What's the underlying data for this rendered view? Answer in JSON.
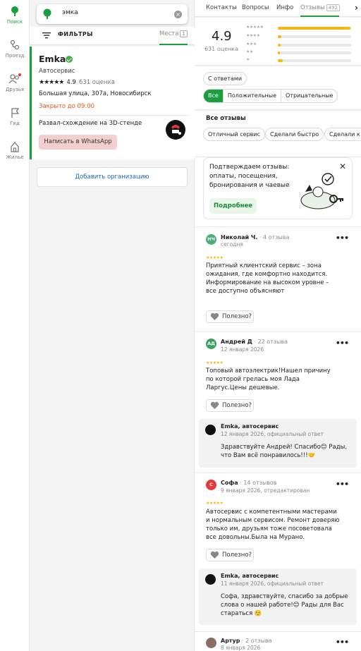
{
  "nav": {
    "items": [
      {
        "label": "Поиск",
        "icon": "search-pin-icon"
      },
      {
        "label": "Проезд",
        "icon": "route-icon"
      },
      {
        "label": "Друзья",
        "icon": "friends-icon"
      },
      {
        "label": "Гид",
        "icon": "flag-icon"
      },
      {
        "label": "Жильё",
        "icon": "home-icon"
      }
    ]
  },
  "search": {
    "query": "эмка"
  },
  "filters": {
    "label": "ФИЛЬТРЫ",
    "places_label": "Места",
    "places_count": "1"
  },
  "org": {
    "name": "Emka",
    "category": "Автосервис",
    "rating": "4.9",
    "reviews": "631 оценка",
    "address": "Большая улица, 307а, Новосибирск",
    "hours": "Закрыто до 09:00",
    "service": "Развал-схождение на 3D-стенде",
    "whatsapp": "Написать в WhatsApp",
    "accent": "#1a9e3f"
  },
  "add_org": "Добавить организацию",
  "tabs": [
    {
      "label": "Контакты"
    },
    {
      "label": "Вопросы"
    },
    {
      "label": "Инфо"
    },
    {
      "label": "Отзывы",
      "badge": "492"
    }
  ],
  "summary": {
    "avg": "4.9",
    "count": "631 оценка",
    "bars": [
      {
        "stars": "★★★★★",
        "fraction": 0.99
      },
      {
        "stars": "★★★★",
        "fraction": 0.05
      },
      {
        "stars": "★★★",
        "fraction": 0.04
      },
      {
        "stars": "★★",
        "fraction": 0.03
      },
      {
        "stars": "★",
        "fraction": 0.07
      }
    ]
  },
  "review_filters": {
    "with_answers": "С ответами",
    "segments": [
      "Все",
      "Положительные",
      "Отрицательные"
    ],
    "all_title": "Все отзывы",
    "tags": [
      "Отличный сервис",
      "Сделали быстро",
      "Сделали к"
    ]
  },
  "promo": {
    "text": "Подтверждаем отзывы: оплаты, посещения, бронирования и чаевые",
    "button": "Подробнее"
  },
  "reviews": [
    {
      "initials": "НЧ",
      "color": "#4caf7a",
      "author": "Николай Ч.",
      "count": "4 отзыва",
      "date": "сегодня",
      "stars": "★★★★★",
      "text": "Приятный клиентский сервис – зона ожидания, где комфортно находится. Информирование на высоком уровне – все доступно объясняют",
      "useful": "Полезно?"
    },
    {
      "initials": "АД",
      "color": "#3c9f5e",
      "author": "Андрей Д",
      "count": "22 отзыва",
      "date": "12 января 2026",
      "stars": "★★★★★",
      "text": "Топовый автоэлектрик!Нашел причину по которой грелась моя Лада Ларгус.Цены дешевые.",
      "useful": "Полезно?",
      "reply": {
        "name": "Emka, автосервис",
        "date": "12 января 2026, официальный ответ",
        "text": "Здравствуйте Андрей! Спасибо😊 Рады, что Вам всё понравилось!!!🤝"
      }
    },
    {
      "initials": "С",
      "color": "#e53935",
      "author": "Софа",
      "count": "14 отзывов",
      "date": "9 января 2026, отредактирован",
      "stars": "★★★★★",
      "text": "Автосервис с компетентными мастерами и нормальным сервисом. Ремонт доверяю только им, друзьям тоже посоветовала все довольны.Была на Мурано.",
      "useful": "Полезно?",
      "reply": {
        "name": "Emka, автосервис",
        "date": "11 января 2026, официальный ответ",
        "text": "Софа, здравствуйте, спасибо за добрые слова о нашей работе!😊 Рады для Вас стараться ☺️"
      }
    },
    {
      "initials": "",
      "color": "#8d6e63",
      "author": "Артур",
      "count": "2 отзыва",
      "date": "8 января 2026"
    }
  ]
}
